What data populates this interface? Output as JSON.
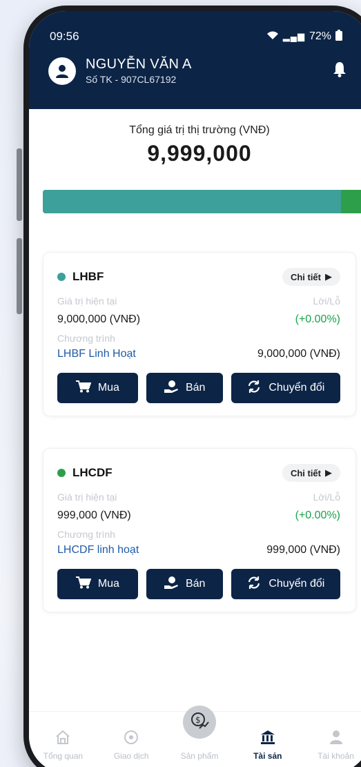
{
  "status_bar": {
    "time": "09:56",
    "battery": "72%"
  },
  "user": {
    "name": "NGUYỄN VĂN A",
    "account": "Số TK - 907CL67192"
  },
  "summary": {
    "label": "Tổng giá trị thị trường (VNĐ)",
    "value": "9,999,000",
    "allocation_fraction": 0.9,
    "colors": {
      "primary": "#3da09a",
      "secondary": "#2d9f4a"
    }
  },
  "funds": [
    {
      "name": "LHBF",
      "dot_color": "#3da09a",
      "detail_label": "Chi tiết",
      "current_value_label": "Giá trị hiện tại",
      "current_value": "9,000,000 (VNĐ)",
      "pl_label": "Lời/Lỗ",
      "pl_value": "(+0.00%)",
      "program_label": "Chương trình",
      "program_name": "LHBF Linh Hoạt",
      "program_value": "9,000,000 (VNĐ)",
      "buy_label": "Mua",
      "sell_label": "Bán",
      "convert_label": "Chuyển đổi"
    },
    {
      "name": "LHCDF",
      "dot_color": "#2d9f4a",
      "detail_label": "Chi tiết",
      "current_value_label": "Giá trị hiện tại",
      "current_value": "999,000 (VNĐ)",
      "pl_label": "Lời/Lỗ",
      "pl_value": "(+0.00%)",
      "program_label": "Chương trình",
      "program_name": "LHCDF linh hoạt",
      "program_value": "999,000 (VNĐ)",
      "buy_label": "Mua",
      "sell_label": "Bán",
      "convert_label": "Chuyển đổi"
    }
  ],
  "tabbar": {
    "overview": "Tổng quan",
    "transactions": "Giao dịch",
    "products": "Sản phẩm",
    "assets": "Tài sản",
    "account": "Tài khoản",
    "active": "assets"
  },
  "colors": {
    "brand": "#0c2446",
    "gain": "#18a34a",
    "link": "#1f5aa6"
  }
}
